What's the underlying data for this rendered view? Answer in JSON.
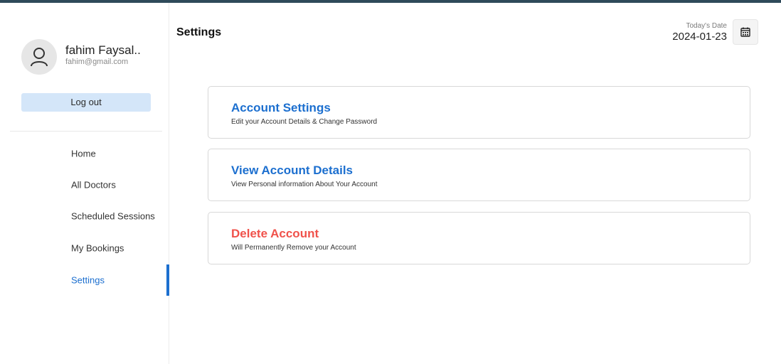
{
  "user": {
    "name": "fahim Faysal..",
    "email": "fahim@gmail.com"
  },
  "sidebar": {
    "logout_label": "Log out",
    "items": [
      {
        "label": "Home"
      },
      {
        "label": "All Doctors"
      },
      {
        "label": "Scheduled Sessions"
      },
      {
        "label": "My Bookings"
      },
      {
        "label": "Settings"
      }
    ],
    "active_item": "Settings"
  },
  "header": {
    "title": "Settings",
    "date_label": "Today's Date",
    "date_value": "2024-01-23",
    "calendar_icon": "calendar-icon"
  },
  "cards": [
    {
      "title": "Account Settings",
      "description": "Edit your Account Details & Change Password",
      "color": "#1c6fcf"
    },
    {
      "title": "View Account Details",
      "description": "View Personal information About Your Account",
      "color": "#1c6fcf"
    },
    {
      "title": "Delete Account",
      "description": "Will Permanently Remove your Account",
      "color": "#f0524b"
    }
  ],
  "colors": {
    "accent": "#1c6fcf",
    "danger": "#f0524b",
    "logout_bg": "#d4e6f9",
    "top_bar": "#2f4a5a"
  }
}
